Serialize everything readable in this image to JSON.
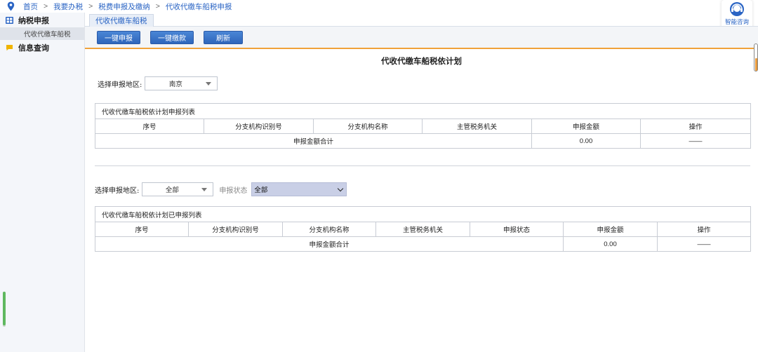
{
  "breadcrumb": {
    "items": [
      "首页",
      "我要办税",
      "税费申报及缴纳",
      "代收代缴车船税申报"
    ],
    "separator": ">"
  },
  "helper": {
    "label": "智能咨询"
  },
  "sidebar": {
    "groups": [
      {
        "label": "纳税申报",
        "icon": "grid-icon",
        "items": [
          {
            "label": "代收代缴车船税"
          }
        ]
      },
      {
        "label": "信息查询",
        "icon": "chat-bubble-icon"
      }
    ]
  },
  "tabs": [
    {
      "label": "代收代缴车船税"
    }
  ],
  "toolbar": {
    "buttons": [
      "一键申报",
      "一键缴款",
      "刷新"
    ]
  },
  "main": {
    "title": "代收代缴车船税依计划",
    "section1": {
      "region_label": "选择申报地区:",
      "region_value": "南京",
      "table_caption": "代收代缴车船税依计划申报列表",
      "columns": [
        "序号",
        "分支机构识别号",
        "分支机构名称",
        "主管税务机关",
        "申报金额",
        "操作"
      ],
      "total_label": "申报金额合计",
      "total_amount": "0.00",
      "total_action": "——"
    },
    "section2": {
      "region_label": "选择申报地区:",
      "region_value": "全部",
      "status_label": "申报状态",
      "status_value": "全部",
      "table_caption": "代收代缴车船税依计划已申报列表",
      "columns": [
        "序号",
        "分支机构识别号",
        "分支机构名称",
        "主管税务机关",
        "申报状态",
        "申报金额",
        "操作"
      ],
      "total_label": "申报金额合计",
      "total_amount": "0.00",
      "total_action": "——"
    }
  },
  "colors": {
    "accent": "#2f66bb",
    "orange_rule": "#f0a23a",
    "link": "#2a64c4"
  }
}
